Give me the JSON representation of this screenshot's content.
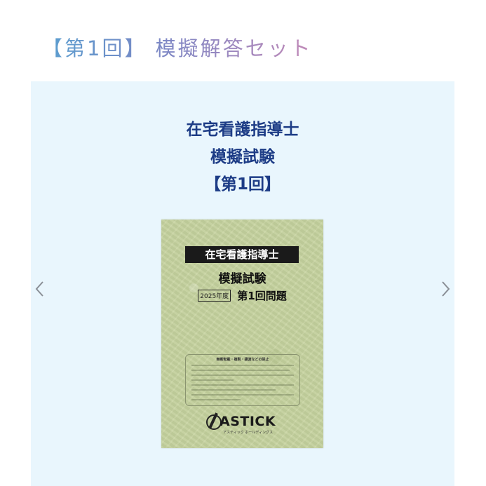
{
  "heading": "【第1回】 模擬解答セット",
  "product": {
    "title_lines": [
      "在宅看護指導士",
      "模擬試験",
      "【第1回】"
    ]
  },
  "book_cover": {
    "banner": "在宅看護指導士",
    "subtitle": "模擬試験",
    "year": "2025年度",
    "exam": "第1回問題",
    "notice_title": "無断転載・複製・譲渡などの禁止",
    "logo_text": "ASTICK",
    "logo_sub": "アスティック ホールディングス"
  },
  "carousel": {
    "prev_icon": "chevron-left-icon",
    "next_icon": "chevron-right-icon"
  },
  "colors": {
    "heading_gradient": [
      "#5a9fd0",
      "#7c86c4",
      "#c28ab8"
    ],
    "panel_bg": "#e9f6fd",
    "title_color": "#1d3c86",
    "cover_bg": "#c7d4a0"
  }
}
